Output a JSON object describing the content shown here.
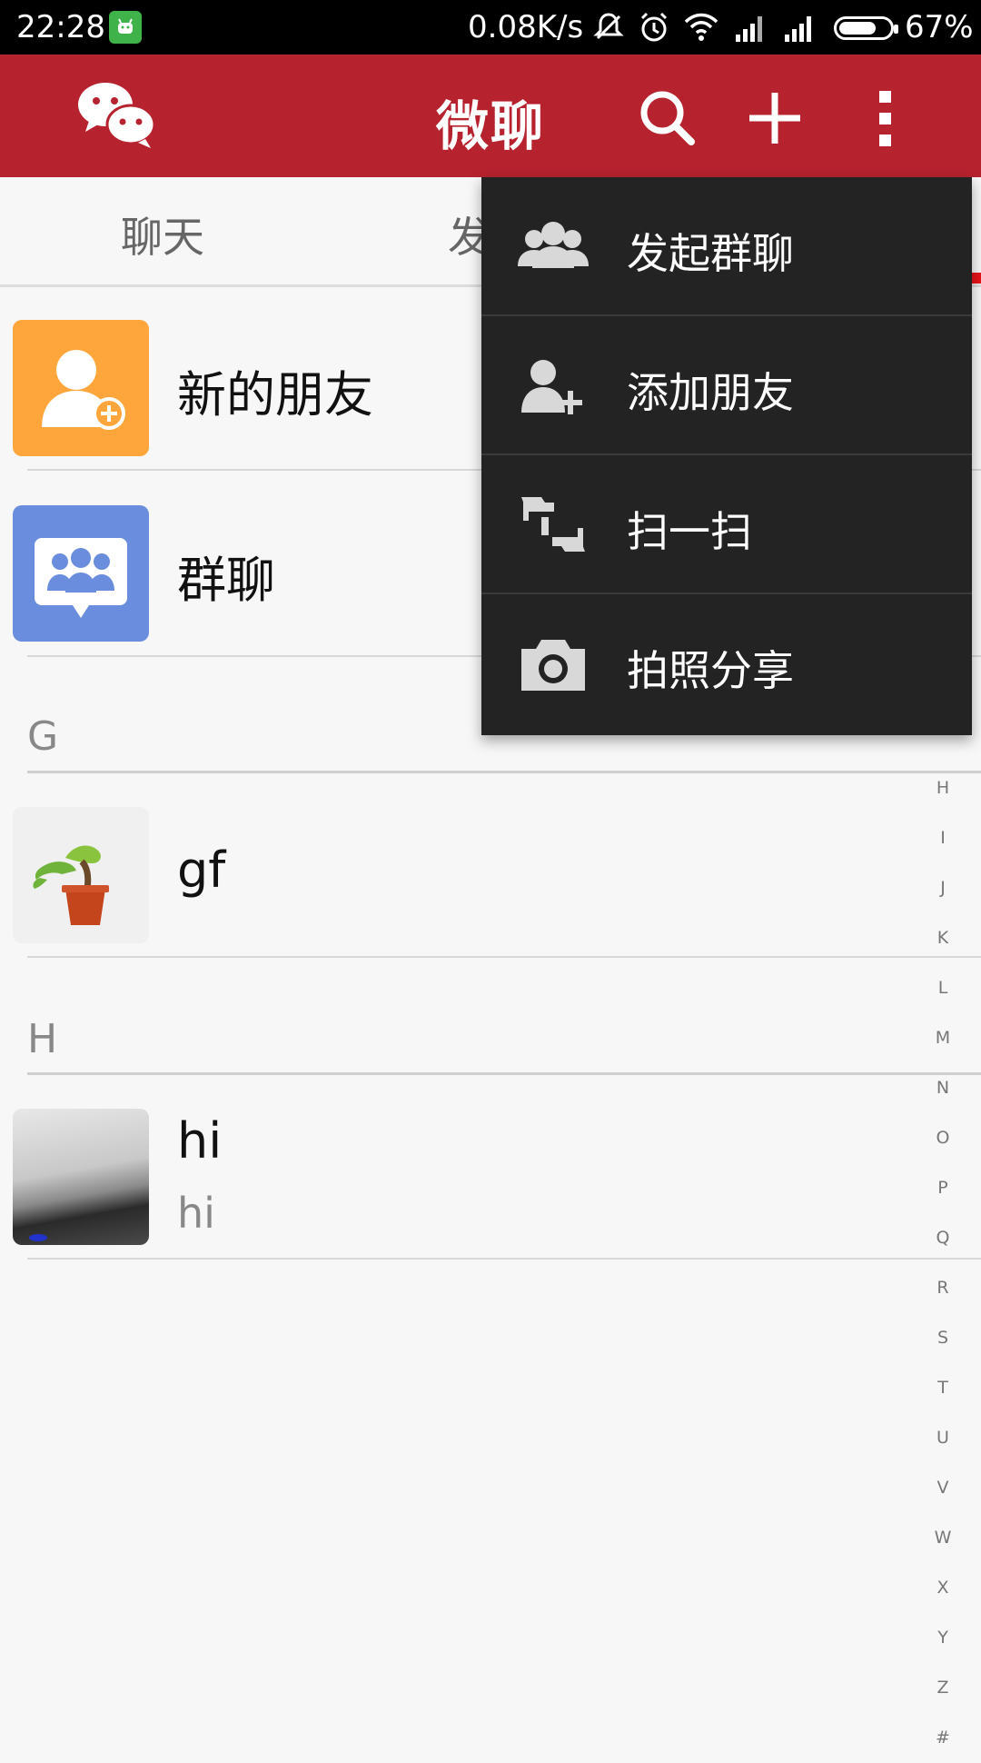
{
  "status_bar": {
    "time": "22:28",
    "speed": "0.08K/s",
    "battery": "67%"
  },
  "app_bar": {
    "title": "微聊",
    "icons": [
      "wechat-logo-icon",
      "search-icon",
      "plus-icon",
      "more-vert-icon"
    ]
  },
  "tabs": {
    "items": [
      {
        "label": "聊天"
      },
      {
        "label": "发"
      }
    ]
  },
  "contacts": {
    "special": [
      {
        "name": "新的朋友",
        "icon": "add-friend-icon",
        "color": "#fea63c"
      },
      {
        "name": "群聊",
        "icon": "group-chat-icon",
        "color": "#6b8ddd"
      }
    ],
    "sections": [
      {
        "letter": "G",
        "items": [
          {
            "name": "gf",
            "sub": ""
          }
        ]
      },
      {
        "letter": "H",
        "items": [
          {
            "name": "hi",
            "sub": "hi"
          }
        ]
      }
    ]
  },
  "index_bar": [
    "H",
    "I",
    "J",
    "K",
    "L",
    "M",
    "N",
    "O",
    "P",
    "Q",
    "R",
    "S",
    "T",
    "U",
    "V",
    "W",
    "X",
    "Y",
    "Z",
    "#"
  ],
  "popup_menu": {
    "items": [
      {
        "label": "发起群聊",
        "icon": "group-icon"
      },
      {
        "label": "添加朋友",
        "icon": "add-person-icon"
      },
      {
        "label": "扫一扫",
        "icon": "scan-icon"
      },
      {
        "label": "拍照分享",
        "icon": "camera-icon"
      }
    ]
  },
  "colors": {
    "app_bar": "#b7222f",
    "menu_bg": "#232323",
    "indicator": "#e8141a"
  }
}
